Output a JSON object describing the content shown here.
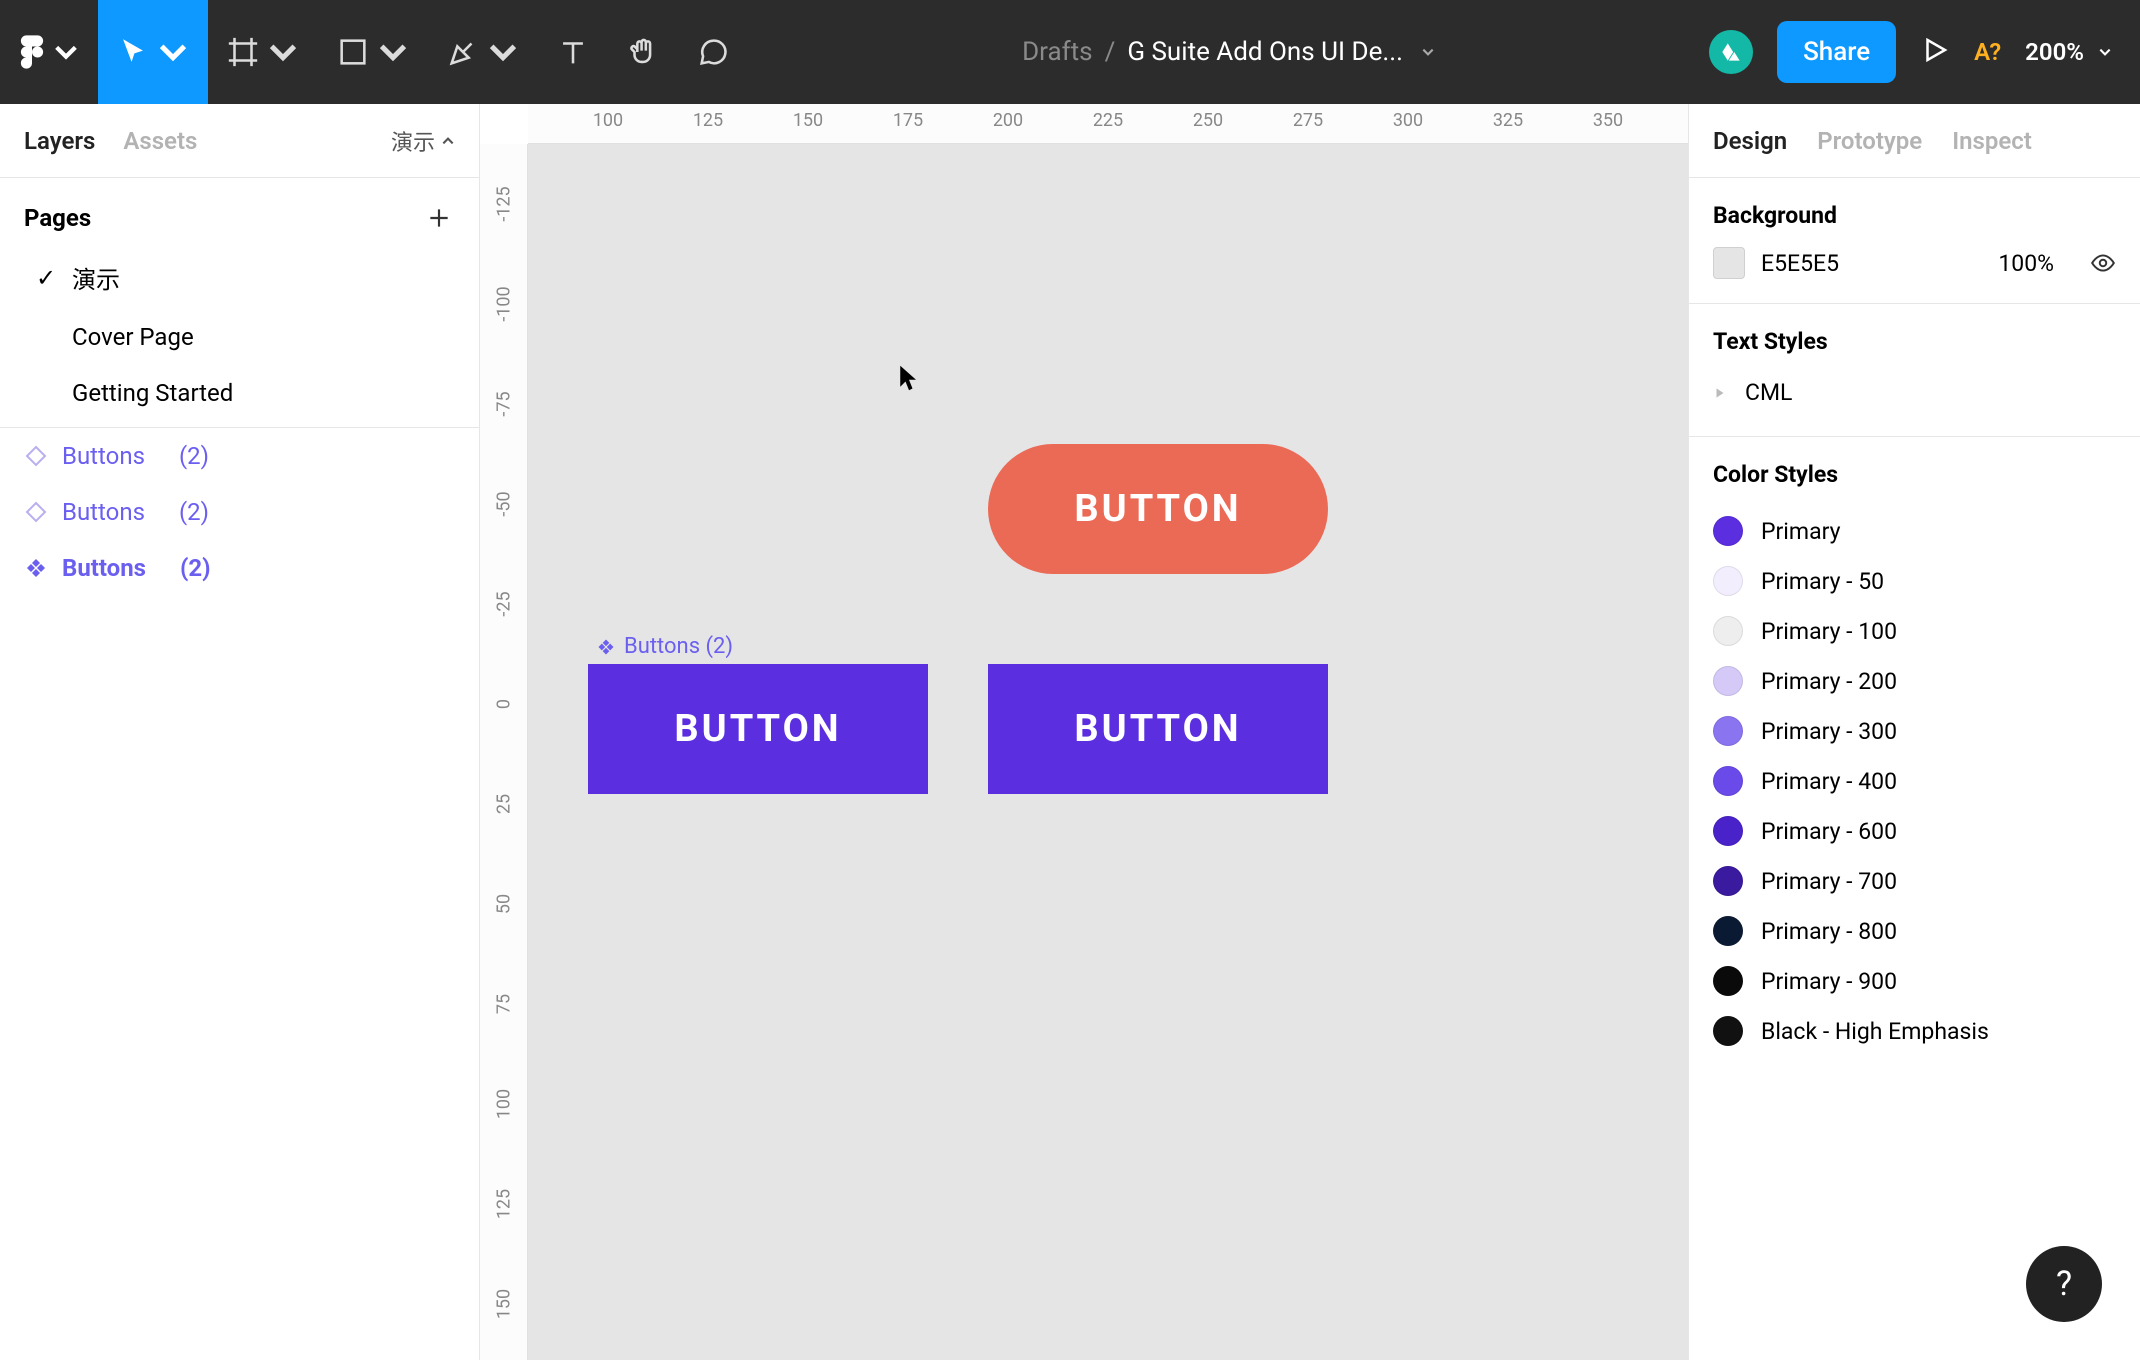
{
  "toolbar": {
    "location": "Drafts",
    "separator": "/",
    "title": "G Suite Add Ons UI De...",
    "share_label": "Share",
    "missing_fonts": "A?",
    "zoom": "200%"
  },
  "left_panel": {
    "tabs": {
      "layers": "Layers",
      "assets": "Assets"
    },
    "page_selector": "演示",
    "pages_header": "Pages",
    "pages": [
      {
        "name": "演示",
        "current": true
      },
      {
        "name": "Cover Page",
        "current": false
      },
      {
        "name": "Getting Started",
        "current": false
      }
    ],
    "layers": [
      {
        "name": "Buttons",
        "count": "(2)",
        "bold": false,
        "icon": "diamond-outline"
      },
      {
        "name": "Buttons",
        "count": "(2)",
        "bold": false,
        "icon": "diamond-outline"
      },
      {
        "name": "Buttons",
        "count": "(2)",
        "bold": true,
        "icon": "diamond-filled"
      }
    ]
  },
  "canvas": {
    "ruler_h": [
      "100",
      "125",
      "150",
      "175",
      "200",
      "225",
      "250",
      "275",
      "300",
      "325",
      "350"
    ],
    "ruler_v": [
      "-125",
      "-100",
      "-75",
      "-50",
      "-25",
      "0",
      "25",
      "50",
      "75",
      "100",
      "125",
      "150"
    ],
    "component_label": "Buttons  (2)",
    "shapes": {
      "red_pill": {
        "text": "BUTTON"
      },
      "purple_1": {
        "text": "BUTTON"
      },
      "purple_2": {
        "text": "BUTTON"
      }
    }
  },
  "right_panel": {
    "tabs": {
      "design": "Design",
      "prototype": "Prototype",
      "inspect": "Inspect"
    },
    "background": {
      "title": "Background",
      "hex": "E5E5E5",
      "opacity": "100%"
    },
    "text_styles": {
      "title": "Text Styles",
      "items": [
        "CML"
      ]
    },
    "color_styles": {
      "title": "Color Styles",
      "items": [
        {
          "name": "Primary",
          "hex": "#5b2ee0"
        },
        {
          "name": "Primary - 50",
          "hex": "#f2eefe"
        },
        {
          "name": "Primary - 100",
          "hex": "#eeeeee"
        },
        {
          "name": "Primary - 200",
          "hex": "#d4c9f7"
        },
        {
          "name": "Primary - 300",
          "hex": "#8b74f0"
        },
        {
          "name": "Primary - 400",
          "hex": "#6a4ae8"
        },
        {
          "name": "Primary - 600",
          "hex": "#4a22c9"
        },
        {
          "name": "Primary - 700",
          "hex": "#3a1a9e"
        },
        {
          "name": "Primary - 800",
          "hex": "#0b1a33"
        },
        {
          "name": "Primary - 900",
          "hex": "#0a0a0a"
        },
        {
          "name": "Black - High Emphasis",
          "hex": "#111111"
        }
      ]
    }
  },
  "help": "?"
}
